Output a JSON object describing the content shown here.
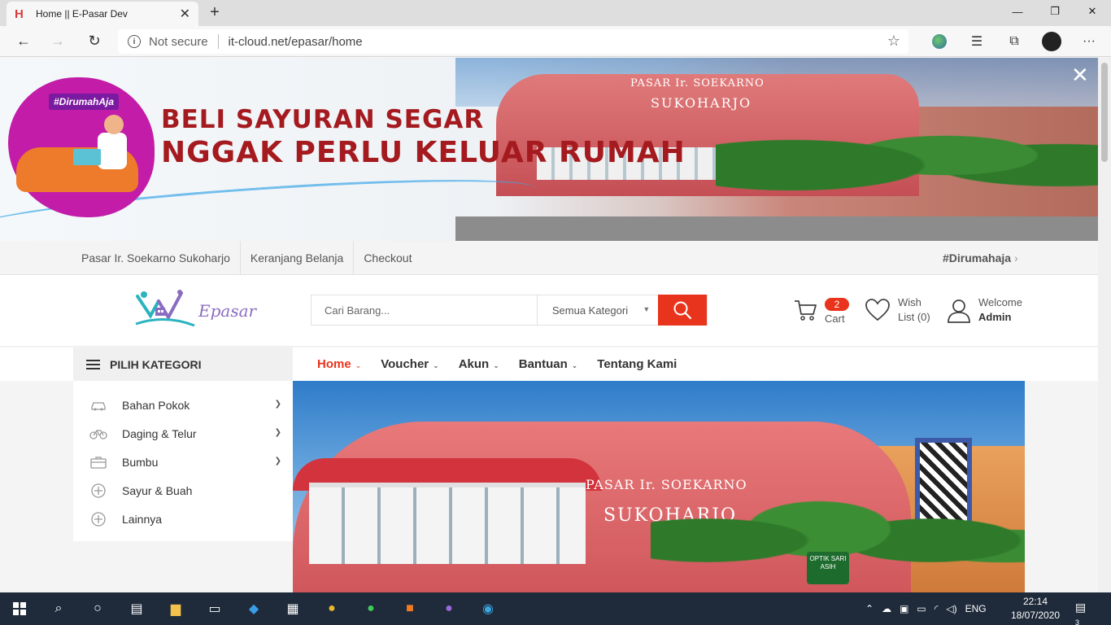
{
  "browser": {
    "tab_title": "Home || E-Pasar Dev",
    "not_secure": "Not secure",
    "url": "it-cloud.net/epasar/home"
  },
  "promo": {
    "hashtag": "#DirumahAja",
    "headline_line1": "BELI SAYURAN SEGAR",
    "headline_line2": "NGGAK PERLU KELUAR RUMAH",
    "building_sign_line1": "PASAR Ir. SOEKARNO",
    "building_sign_line2": "SUKOHARJO"
  },
  "topnav": {
    "links": [
      "Pasar Ir. Soekarno Sukoharjo",
      "Keranjang Belanja",
      "Checkout"
    ],
    "hashtag": "#Dirumahaja"
  },
  "header": {
    "logo_text": "Epasar",
    "search_placeholder": "Cari Barang...",
    "search_category": "Semua Kategori",
    "cart_count": "2",
    "cart_label": "Cart",
    "wish_line1": "Wish",
    "wish_line2": "List (0)",
    "user_line1": "Welcome",
    "user_line2": "Admin"
  },
  "category_menu": {
    "title": "PILIH KATEGORI",
    "items": [
      {
        "label": "Bahan Pokok",
        "icon": "car-icon",
        "has_submenu": true
      },
      {
        "label": "Daging & Telur",
        "icon": "bicycle-icon",
        "has_submenu": true
      },
      {
        "label": "Bumbu",
        "icon": "briefcase-icon",
        "has_submenu": true
      },
      {
        "label": "Sayur & Buah",
        "icon": "plus-circle-icon",
        "has_submenu": false
      },
      {
        "label": "Lainnya",
        "icon": "plus-circle-icon",
        "has_submenu": false
      }
    ]
  },
  "mainnav": {
    "items": [
      "Home",
      "Voucher",
      "Akun",
      "Bantuan",
      "Tentang Kami"
    ]
  },
  "hero": {
    "sign_line1": "PASAR Ir. SOEKARNO",
    "sign_line2": "SUKOHARJO",
    "shop_sign": "OPTIK SARI ASIH"
  },
  "taskbar": {
    "language": "ENG",
    "time": "22:14",
    "date": "18/07/2020",
    "notifications": "3"
  },
  "colors": {
    "accent": "#e8341c",
    "promo_headline": "#a41a1f",
    "logo_purple": "#8a6cc0",
    "taskbar": "#1f2a3a"
  }
}
